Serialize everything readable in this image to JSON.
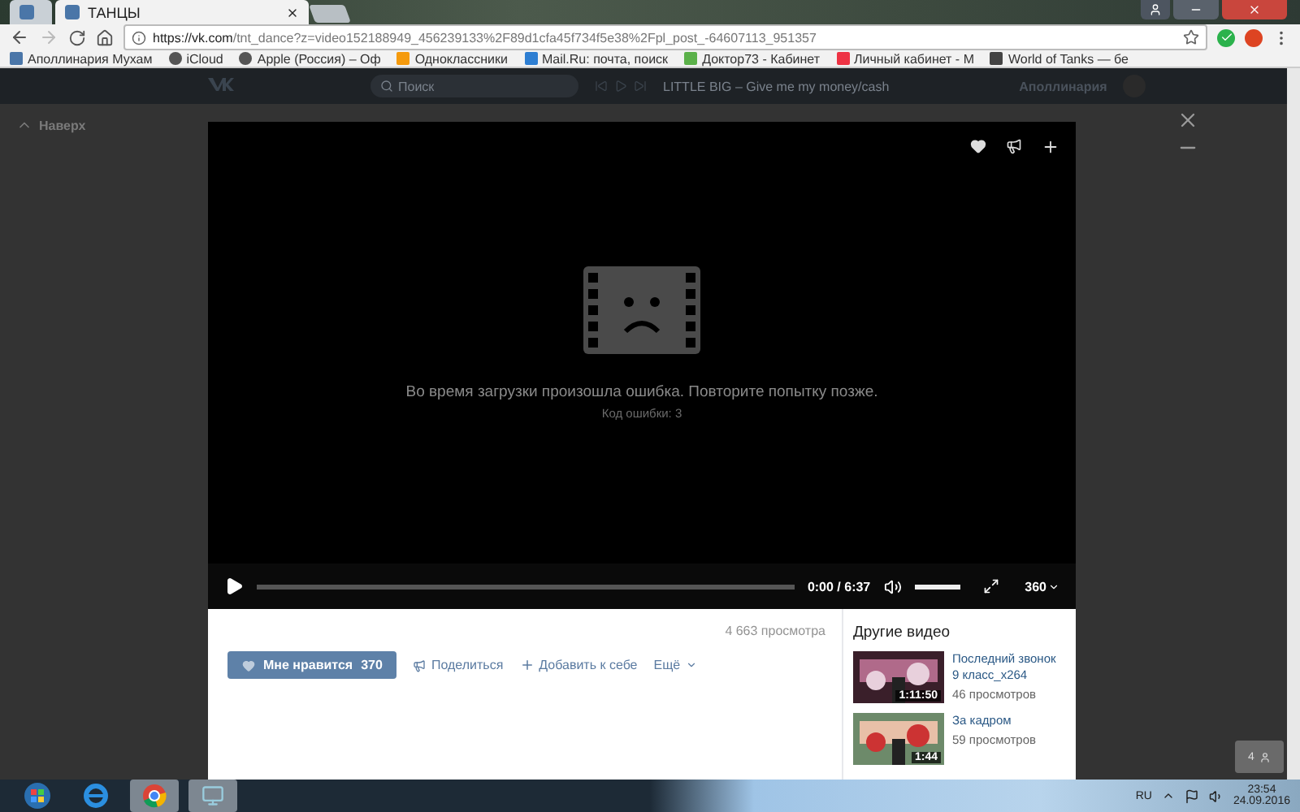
{
  "browser": {
    "tabs": [
      {
        "selected": false
      },
      {
        "title": "ТАНЦЫ",
        "selected": true
      }
    ],
    "url_host": "https://vk.com",
    "url_path": "/tnt_dance?z=video152188949_456239133%2F89d1cfa45f734f5e38%2Fpl_post_-64607113_951357",
    "bookmarks": [
      {
        "label": "Аполлинария Мухам",
        "kind": "vk"
      },
      {
        "label": "iCloud",
        "kind": "apple"
      },
      {
        "label": "Apple (Россия) – Оф",
        "kind": "apple"
      },
      {
        "label": "Одноклассники",
        "kind": "ok"
      },
      {
        "label": "Mail.Ru: почта, поиск",
        "kind": "mail"
      },
      {
        "label": "Доктор73 - Кабинет",
        "kind": "doc"
      },
      {
        "label": "Личный кабинет - М",
        "kind": "dots"
      },
      {
        "label": "World of Tanks — бе",
        "kind": "wot"
      }
    ]
  },
  "header": {
    "search_placeholder": "Поиск",
    "now_playing": "LITTLE BIG – Give me my money/cash",
    "user": "Аполлинария"
  },
  "sidebar": {
    "up": "Наверх"
  },
  "video": {
    "error": "Во время загрузки произошла ошибка. Повторите попытку позже.",
    "error_code": "Код ошибки: 3",
    "time": "0:00 / 6:37",
    "progress": {
      "level": 0
    },
    "volume": {
      "level": 1
    },
    "quality": "360"
  },
  "info": {
    "views": "4 663 просмотра",
    "like_label": "Мне нравится",
    "like_count": "370",
    "share": "Поделиться",
    "add": "Добавить к себе",
    "more": "Ещё"
  },
  "other_videos": {
    "title": "Другие видео",
    "items": [
      {
        "title": "Последний звонок 9 класс_x264",
        "duration": "1:11:50",
        "views": "46 просмотров"
      },
      {
        "title": "За кадром",
        "duration": "1:44",
        "views": "59 просмотров"
      }
    ]
  },
  "friends_badge": "4",
  "taskbar": {
    "language": "RU",
    "time": "23:54",
    "date": "24.09.2016"
  }
}
